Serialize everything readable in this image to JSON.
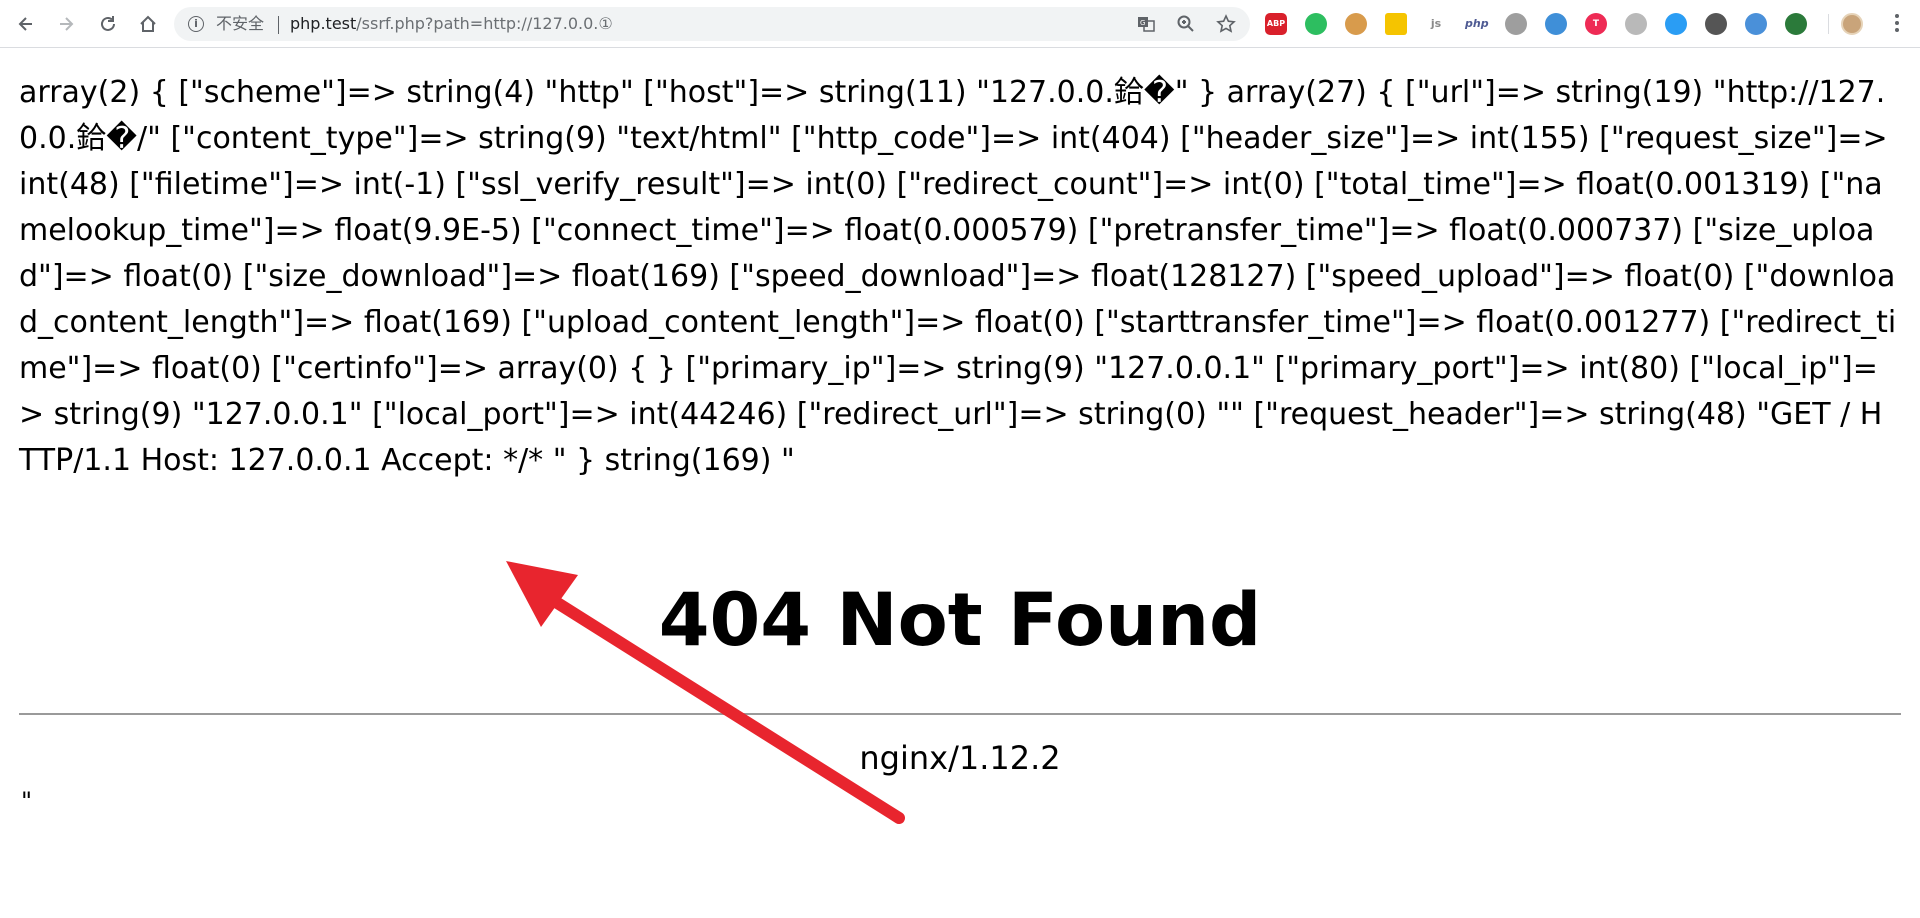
{
  "browser": {
    "security_label": "不安全",
    "url_host": "php.test",
    "url_path": "/ssrf.php?path=http://127.0.0.①",
    "extensions": [
      {
        "name": "abp-extension-icon",
        "label": "ABP",
        "color": "#d9202b"
      },
      {
        "name": "evernote-extension-icon",
        "label": "",
        "color": "#2dbe60"
      },
      {
        "name": "cookie-extension-icon",
        "label": "",
        "color": "#d89b4c"
      },
      {
        "name": "menu-extension-icon",
        "label": "",
        "color": "#f5c400"
      },
      {
        "name": "js-extension-icon",
        "label": "js",
        "color": "#8a8a8a"
      },
      {
        "name": "php-extension-icon",
        "label": "php",
        "color": "#4f5b93"
      },
      {
        "name": "circle-extension-icon",
        "label": "",
        "color": "#9e9e9e"
      },
      {
        "name": "globe-extension-icon",
        "label": "",
        "color": "#3f8fd8"
      },
      {
        "name": "t-extension-icon",
        "label": "T",
        "color": "#ee2b55"
      },
      {
        "name": "link-extension-icon",
        "label": "",
        "color": "#b9b9b9"
      },
      {
        "name": "check-extension-icon",
        "label": "",
        "color": "#2a9df4"
      },
      {
        "name": "chart-extension-icon",
        "label": "",
        "color": "#555555"
      },
      {
        "name": "edge-extension-icon",
        "label": "",
        "color": "#4a90d9"
      },
      {
        "name": "green-extension-icon",
        "label": "",
        "color": "#2b7a3a"
      }
    ]
  },
  "page": {
    "dump_text": "array(2) { [\"scheme\"]=> string(4) \"http\" [\"host\"]=> string(11) \"127.0.0.鉿�\" } array(27) { [\"url\"]=> string(19) \"http://127.0.0.鉿�/\" [\"content_type\"]=> string(9) \"text/html\" [\"http_code\"]=> int(404) [\"header_size\"]=> int(155) [\"request_size\"]=> int(48) [\"filetime\"]=> int(-1) [\"ssl_verify_result\"]=> int(0) [\"redirect_count\"]=> int(0) [\"total_time\"]=> float(0.001319) [\"namelookup_time\"]=> float(9.9E-5) [\"connect_time\"]=> float(0.000579) [\"pretransfer_time\"]=> float(0.000737) [\"size_upload\"]=> float(0) [\"size_download\"]=> float(169) [\"speed_download\"]=> float(128127) [\"speed_upload\"]=> float(0) [\"download_content_length\"]=> float(169) [\"upload_content_length\"]=> float(0) [\"starttransfer_time\"]=> float(0.001277) [\"redirect_time\"]=> float(0) [\"certinfo\"]=> array(0) { } [\"primary_ip\"]=> string(9) \"127.0.0.1\" [\"primary_port\"]=> int(80) [\"local_ip\"]=> string(9) \"127.0.0.1\" [\"local_port\"]=> int(44246) [\"redirect_url\"]=> string(0) \"\" [\"request_header\"]=> string(48) \"GET / HTTP/1.1 Host: 127.0.0.1 Accept: */* \" } string(169) \"",
    "not_found_title": "404 Not Found",
    "server_signature": "nginx/1.12.2",
    "trailing_quote": "\"",
    "arrow_color": "#e8252e"
  }
}
